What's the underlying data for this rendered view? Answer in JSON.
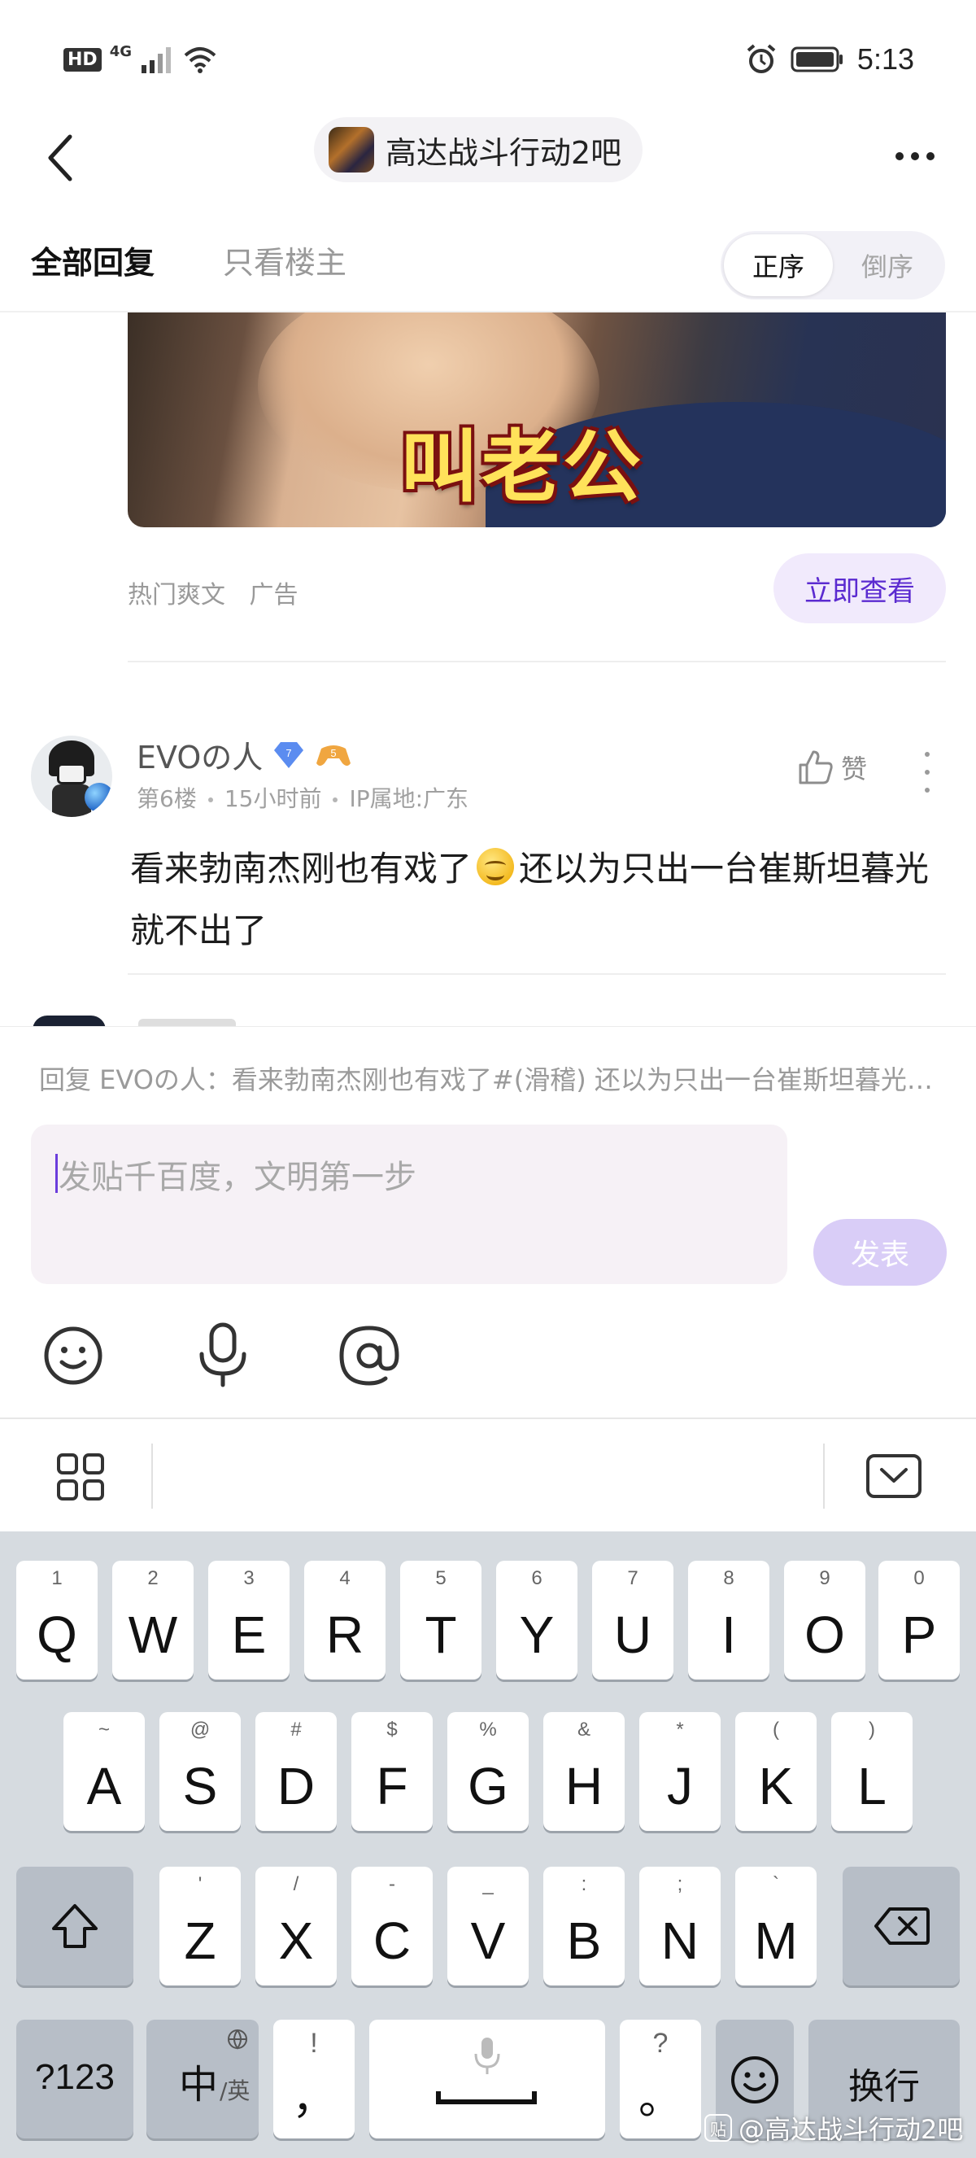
{
  "status_bar": {
    "network_hd": "HD",
    "network_type": "4G",
    "time": "5:13"
  },
  "header": {
    "forum_name": "高达战斗行动2吧"
  },
  "tabs": {
    "all_replies": "全部回复",
    "op_only": "只看楼主",
    "sort_asc": "正序",
    "sort_desc": "倒序"
  },
  "ad": {
    "image_caption": "叫老公",
    "source": "热门爽文",
    "ad_label": "广告",
    "cta": "立即查看"
  },
  "reply": {
    "username": "EVOの人",
    "level": "7",
    "game_level": "5",
    "floor": "第6楼",
    "time_ago": "15小时前",
    "ip_location": "IP属地:广东",
    "like_label": "赞",
    "text_part1": "看来勃南杰刚也有戏了",
    "emoji_name": "滑稽",
    "text_part2": "还以为只出一台崔斯坦暮光就不出了"
  },
  "composer": {
    "reply_to": "回复 EVOの人：看来勃南杰刚也有戏了#(滑稽) 还以为只出一台崔斯坦暮光就不出了",
    "placeholder": "发贴千百度，文明第一步",
    "send_label": "发表"
  },
  "keyboard": {
    "row1": [
      {
        "main": "Q",
        "hint": "1"
      },
      {
        "main": "W",
        "hint": "2"
      },
      {
        "main": "E",
        "hint": "3"
      },
      {
        "main": "R",
        "hint": "4"
      },
      {
        "main": "T",
        "hint": "5"
      },
      {
        "main": "Y",
        "hint": "6"
      },
      {
        "main": "U",
        "hint": "7"
      },
      {
        "main": "I",
        "hint": "8"
      },
      {
        "main": "O",
        "hint": "9"
      },
      {
        "main": "P",
        "hint": "0"
      }
    ],
    "row2": [
      {
        "main": "A",
        "hint": "~"
      },
      {
        "main": "S",
        "hint": "@"
      },
      {
        "main": "D",
        "hint": "#"
      },
      {
        "main": "F",
        "hint": "$"
      },
      {
        "main": "G",
        "hint": "%"
      },
      {
        "main": "H",
        "hint": "&"
      },
      {
        "main": "J",
        "hint": "*"
      },
      {
        "main": "K",
        "hint": "("
      },
      {
        "main": "L",
        "hint": ")"
      }
    ],
    "row3": [
      {
        "main": "Z",
        "hint": "'"
      },
      {
        "main": "X",
        "hint": "/"
      },
      {
        "main": "C",
        "hint": "-"
      },
      {
        "main": "V",
        "hint": "_"
      },
      {
        "main": "B",
        "hint": ":"
      },
      {
        "main": "N",
        "hint": ";"
      },
      {
        "main": "M",
        "hint": "`"
      }
    ],
    "symbols_key": "?123",
    "lang_key_main": "中",
    "lang_key_sub": "/英",
    "comma_key_main": "，",
    "comma_key_hint": "!",
    "period_key_main": "。",
    "period_key_hint": "?",
    "enter_key": "换行"
  },
  "watermark": {
    "logo_text": "贴",
    "text": "@高达战斗行动2吧"
  }
}
